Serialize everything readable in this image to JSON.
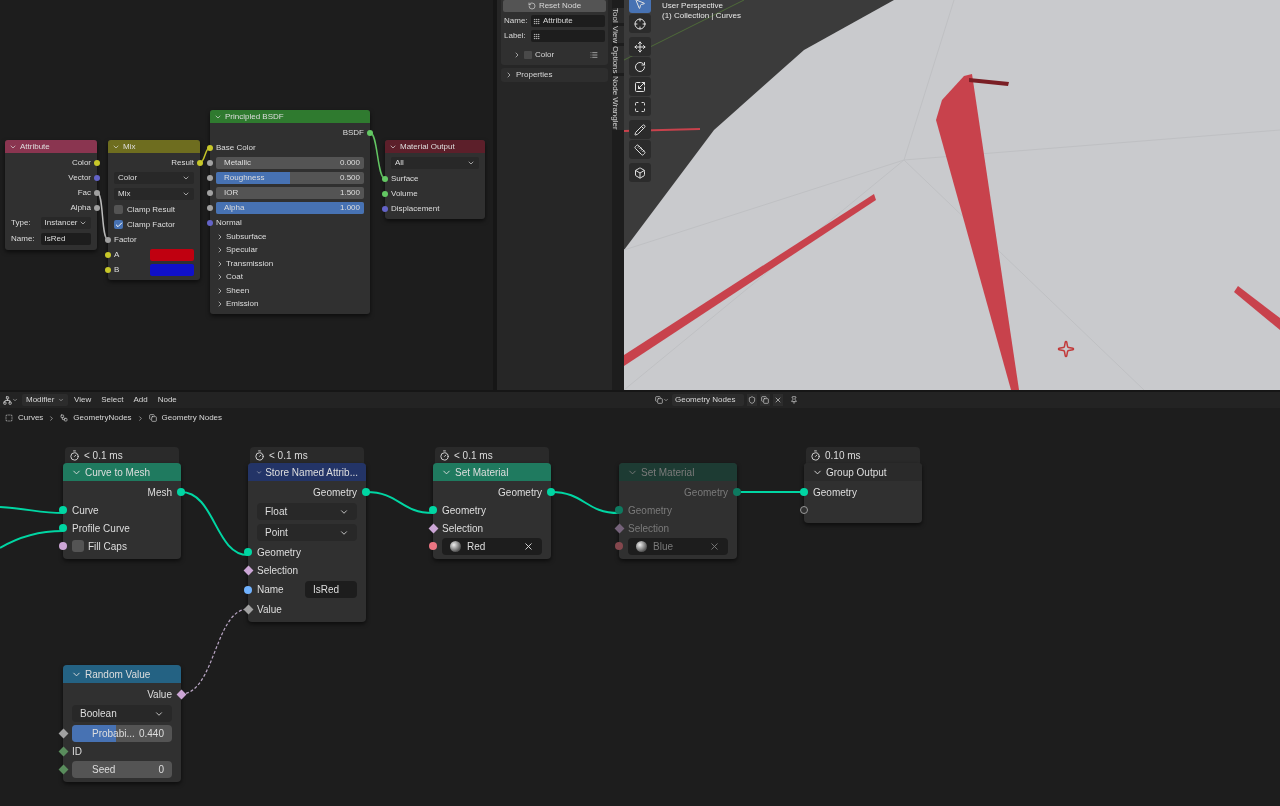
{
  "shader_editor": {
    "nodes": [
      {
        "title": "Attribute",
        "color": "#8a3550",
        "rows": [
          {
            "kind": "output",
            "label": "Color",
            "socket": {
              "kind": "circle",
              "color": "#c7c729"
            }
          },
          {
            "kind": "output",
            "label": "Vector",
            "socket": {
              "kind": "circle",
              "color": "#6363c7"
            }
          },
          {
            "kind": "output",
            "label": "Fac",
            "socket": {
              "kind": "circle",
              "color": "#a1a1a1"
            }
          },
          {
            "kind": "output",
            "label": "Alpha",
            "socket": {
              "kind": "circle",
              "color": "#a1a1a1"
            }
          },
          {
            "kind": "dropdown",
            "label": "Type:",
            "value": "Instancer"
          },
          {
            "kind": "text_field",
            "label": "Name:",
            "value": "IsRed"
          }
        ]
      },
      {
        "title": "Mix",
        "color": "#6e6d1f",
        "rows": [
          {
            "kind": "output",
            "label": "Result",
            "socket": {
              "kind": "circle",
              "color": "#c7c729"
            }
          },
          {
            "kind": "dropdown",
            "value": "Color"
          },
          {
            "kind": "dropdown",
            "value": "Mix"
          },
          {
            "kind": "checkbox",
            "label": "Clamp Result",
            "checked": false
          },
          {
            "kind": "checkbox",
            "label": "Clamp Factor",
            "checked": true
          },
          {
            "kind": "input",
            "label": "Factor",
            "socket": {
              "kind": "circle",
              "color": "#a1a1a1"
            }
          },
          {
            "kind": "color",
            "label": "A",
            "socket": {
              "kind": "circle",
              "color": "#c7c729"
            },
            "color": "#c00010"
          },
          {
            "kind": "color",
            "label": "B",
            "socket": {
              "kind": "circle",
              "color": "#c7c729"
            },
            "color": "#1010c8"
          }
        ]
      },
      {
        "title": "Principled BSDF",
        "color": "#2f7a2f",
        "rows": [
          {
            "kind": "output",
            "label": "BSDF",
            "socket": {
              "kind": "circle",
              "color": "#63c763"
            }
          },
          {
            "kind": "input",
            "label": "Base Color",
            "socket": {
              "kind": "circle",
              "color": "#c7c729"
            }
          },
          {
            "kind": "number",
            "label": "Metallic",
            "value": "0.000",
            "socket": {
              "kind": "circle",
              "color": "#a1a1a1"
            }
          },
          {
            "kind": "slider",
            "label": "Roughness",
            "value": "0.500",
            "level": 0.5,
            "socket": {
              "kind": "circle",
              "color": "#a1a1a1"
            }
          },
          {
            "kind": "number",
            "label": "IOR",
            "value": "1.500",
            "socket": {
              "kind": "circle",
              "color": "#a1a1a1"
            }
          },
          {
            "kind": "slider",
            "label": "Alpha",
            "value": "1.000",
            "level": 1,
            "socket": {
              "kind": "circle",
              "color": "#a1a1a1"
            }
          },
          {
            "kind": "input",
            "label": "Normal",
            "socket": {
              "kind": "circle",
              "color": "#6363c7"
            }
          },
          {
            "kind": "panel",
            "label": "Subsurface"
          },
          {
            "kind": "panel",
            "label": "Specular"
          },
          {
            "kind": "panel",
            "label": "Transmission"
          },
          {
            "kind": "panel",
            "label": "Coat"
          },
          {
            "kind": "panel",
            "label": "Sheen"
          },
          {
            "kind": "panel",
            "label": "Emission"
          }
        ]
      },
      {
        "title": "Material Output",
        "color": "#5c1f2a",
        "rows": [
          {
            "kind": "dropdown",
            "value": "All"
          },
          {
            "kind": "input",
            "label": "Surface",
            "socket": {
              "kind": "circle",
              "color": "#63c763"
            }
          },
          {
            "kind": "input",
            "label": "Volume",
            "socket": {
              "kind": "circle",
              "color": "#63c763"
            }
          },
          {
            "kind": "input",
            "label": "Displacement",
            "socket": {
              "kind": "circle",
              "color": "#6363c7"
            }
          }
        ]
      }
    ]
  },
  "sidebar": {
    "reset_button": "Reset Node",
    "name_label": "Name:",
    "name_value": "Attribute",
    "label_label": "Label:",
    "color_panel": {
      "label": "Color",
      "checked": false,
      "expanded": false
    },
    "properties_panel": {
      "label": "Properties",
      "expanded": false
    }
  },
  "sidebar_tabs": [
    {
      "label": "Tool",
      "selected": false
    },
    {
      "label": "View",
      "selected": false
    },
    {
      "label": "Options",
      "selected": false
    },
    {
      "label": "Node Wrangler",
      "selected": false
    }
  ],
  "viewport": {
    "view_name": "User Perspective",
    "collection": "(1) Collection | Curves",
    "tools": [
      {
        "selected": true
      },
      {
        "selected": false
      },
      {
        "selected": false
      },
      {
        "selected": false
      },
      {
        "selected": false
      },
      {
        "selected": false
      },
      {
        "selected": false
      },
      {
        "selected": false
      },
      {
        "selected": false
      }
    ]
  },
  "node_editor_header": {
    "editor_mode": "Modifier",
    "menus": [
      "View",
      "Select",
      "Add",
      "Node"
    ],
    "node_group": "Geometry Nodes"
  },
  "breadcrumbs": [
    "Curves",
    "GeometryNodes",
    "Geometry Nodes"
  ],
  "geometry_nodes": {
    "nodes": [
      {
        "title": "Curve to Mesh",
        "color": "#1f7a5f",
        "timing": "< 0.1 ms",
        "muted": false,
        "rows": [
          {
            "kind": "output",
            "label": "Mesh",
            "socket": {
              "kind": "circle",
              "color": "#00d6a3"
            }
          },
          {
            "kind": "input",
            "label": "Curve",
            "socket": {
              "kind": "circle",
              "color": "#00d6a3"
            }
          },
          {
            "kind": "input",
            "label": "Profile Curve",
            "socket": {
              "kind": "circle",
              "color": "#00d6a3"
            }
          },
          {
            "kind": "checkbox",
            "label": "Fill Caps",
            "checked": false,
            "socket": {
              "kind": "circle",
              "color": "#cca6d6"
            }
          }
        ]
      },
      {
        "title": "Store Named Attrib...",
        "color": "#233467",
        "timing": "< 0.1 ms",
        "muted": false,
        "rows": [
          {
            "kind": "output",
            "label": "Geometry",
            "socket": {
              "kind": "circle",
              "color": "#00d6a3"
            }
          },
          {
            "kind": "dropdown",
            "value": "Float"
          },
          {
            "kind": "dropdown",
            "value": "Point"
          },
          {
            "kind": "input",
            "label": "Geometry",
            "socket": {
              "kind": "circle",
              "color": "#00d6a3"
            }
          },
          {
            "kind": "input",
            "label": "Selection",
            "socket": {
              "kind": "diamond",
              "color": "#cca6d6"
            }
          },
          {
            "kind": "text_field",
            "label": "Name",
            "value": "IsRed",
            "socket": {
              "kind": "circle",
              "color": "#70b2ff"
            }
          },
          {
            "kind": "input",
            "label": "Value",
            "socket": {
              "kind": "diamond",
              "color": "#a1a1a1"
            }
          }
        ]
      },
      {
        "title": "Set Material",
        "color": "#1f7a5f",
        "timing": "< 0.1 ms",
        "muted": false,
        "rows": [
          {
            "kind": "output",
            "label": "Geometry",
            "socket": {
              "kind": "circle",
              "color": "#00d6a3"
            }
          },
          {
            "kind": "input",
            "label": "Geometry",
            "socket": {
              "kind": "circle",
              "color": "#00d6a3"
            }
          },
          {
            "kind": "input",
            "label": "Selection",
            "socket": {
              "kind": "diamond",
              "color": "#cca6d6"
            }
          },
          {
            "kind": "material",
            "value": "Red",
            "socket": {
              "kind": "circle",
              "color": "#eb7582"
            }
          }
        ]
      },
      {
        "title": "Set Material",
        "color": "#1d3b33",
        "muted": true,
        "rows": [
          {
            "kind": "output",
            "label": "Geometry",
            "socket": {
              "kind": "circle",
              "color": "#0e7a60"
            }
          },
          {
            "kind": "input",
            "label": "Geometry",
            "socket": {
              "kind": "circle",
              "color": "#0e7a60"
            }
          },
          {
            "kind": "input",
            "label": "Selection",
            "socket": {
              "kind": "diamond",
              "color": "#75627a"
            }
          },
          {
            "kind": "material",
            "value": "Blue",
            "socket": {
              "kind": "circle",
              "color": "#84474d"
            }
          }
        ]
      },
      {
        "title": "Group Output",
        "color": "#2a2a2a",
        "timing": "0.10 ms",
        "muted": false,
        "rows": [
          {
            "kind": "input",
            "label": "Geometry",
            "socket": {
              "kind": "circle",
              "color": "#00d6a3"
            }
          },
          {
            "kind": "socket_only",
            "socket": {
              "kind": "hollow",
              "color": "#303030"
            }
          }
        ]
      },
      {
        "title": "Random Value",
        "color": "#246283",
        "muted": false,
        "rows": [
          {
            "kind": "output",
            "label": "Value",
            "socket": {
              "kind": "diamond",
              "color": "#cca6d6"
            }
          },
          {
            "kind": "dropdown",
            "value": "Boolean"
          },
          {
            "kind": "slider",
            "label": "Probabi...",
            "value": "0.440",
            "level": 0.44,
            "socket": {
              "kind": "diamond",
              "color": "#a1a1a1"
            }
          },
          {
            "kind": "input",
            "label": "ID",
            "socket": {
              "kind": "diamond",
              "color": "#598c5c"
            }
          },
          {
            "kind": "number",
            "label": "Seed",
            "value": "0",
            "socket": {
              "kind": "diamond",
              "color": "#598c5c"
            }
          }
        ]
      }
    ]
  }
}
